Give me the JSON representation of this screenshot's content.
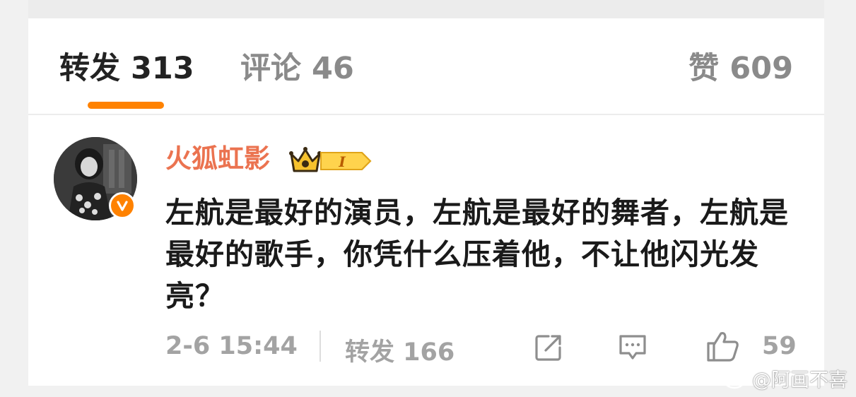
{
  "tabs": {
    "repost_label": "转发 313",
    "comment_label": "评论 46",
    "like_label": "赞 609"
  },
  "comment": {
    "username": "火狐虹影",
    "vip_level": "I",
    "text": "左航是最好的演员，左航是最好的舞者，左航是最好的歌手，你凭什么压着他，不让他闪光发亮？",
    "time": "2-6 15:44",
    "repost_label": "转发 166",
    "like_count": "59"
  },
  "watermark": {
    "text": "@阿画不喜"
  },
  "colors": {
    "accent": "#ff8200",
    "username": "#eb7350",
    "muted": "#a3a3a3"
  },
  "icons": [
    "crown-icon",
    "verified-icon",
    "share-icon",
    "comment-icon",
    "thumbs-up-icon",
    "weibo-logo-icon"
  ]
}
